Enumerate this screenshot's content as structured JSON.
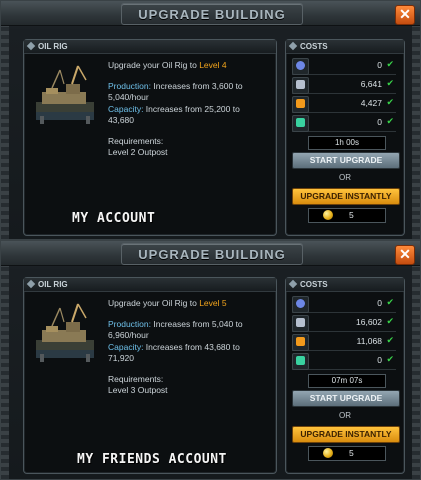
{
  "dialogs": [
    {
      "title": "UPGRADE BUILDING",
      "close_label": "✕",
      "panel_title": "OIL RIG",
      "upgrade_text": "Upgrade your Oil Rig to ",
      "target_level": "Level 4",
      "production_label": "Production:",
      "production_text": " Increases from 3,600 to 5,040/hour",
      "capacity_label": "Capacity:",
      "capacity_text": " Increases from 25,200 to 43,680",
      "requirements_label": "Requirements:",
      "requirements_value": "Level 2 Outpost",
      "costs_title": "COSTS",
      "costs": [
        "0",
        "6,641",
        "4,427",
        "0"
      ],
      "time": "1h 00s",
      "start_label": "START UPGRADE",
      "or_label": "OR",
      "instant_label": "UPGRADE INSTANTLY",
      "gold": "5",
      "annotation": "MY ACCOUNT"
    },
    {
      "title": "UPGRADE BUILDING",
      "close_label": "✕",
      "panel_title": "OIL RIG",
      "upgrade_text": "Upgrade your Oil Rig to ",
      "target_level": "Level 5",
      "production_label": "Production:",
      "production_text": " Increases from 5,040 to 6,960/hour",
      "capacity_label": "Capacity:",
      "capacity_text": " Increases from 43,680 to 71,920",
      "requirements_label": "Requirements:",
      "requirements_value": "Level 3 Outpost",
      "costs_title": "COSTS",
      "costs": [
        "0",
        "16,602",
        "11,068",
        "0"
      ],
      "time": "07m 07s",
      "start_label": "START UPGRADE",
      "or_label": "OR",
      "instant_label": "UPGRADE INSTANTLY",
      "gold": "5",
      "annotation": "MY FRIENDS ACCOUNT"
    }
  ],
  "colors": {
    "level_accent": "#f4a51c",
    "label_blue": "#6fc1ea",
    "check_green": "#39d24a",
    "instant_orange": "#ffc33d"
  }
}
